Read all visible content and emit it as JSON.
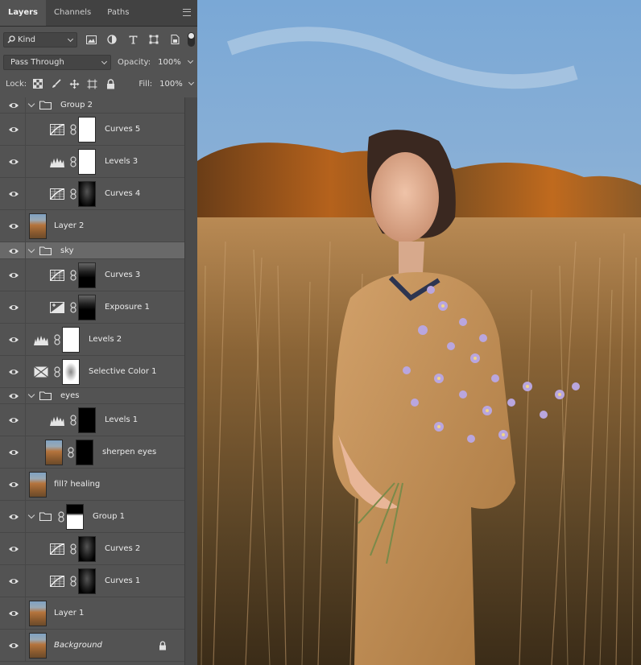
{
  "tabs": [
    "Layers",
    "Channels",
    "Paths"
  ],
  "filter": {
    "kind_label": "Kind"
  },
  "blend": {
    "mode": "Pass Through",
    "opacity_label": "Opacity:",
    "opacity_value": "100%"
  },
  "lockrow": {
    "lock_label": "Lock:",
    "fill_label": "Fill:",
    "fill_value": "100%"
  },
  "layers": [
    {
      "name": "Group 2",
      "type": "group"
    },
    {
      "name": "Curves 5",
      "type": "curves"
    },
    {
      "name": "Levels 3",
      "type": "levels"
    },
    {
      "name": "Curves 4",
      "type": "curves"
    },
    {
      "name": "Layer 2",
      "type": "pixel"
    },
    {
      "name": "sky",
      "type": "group",
      "selected": true
    },
    {
      "name": "Curves 3",
      "type": "curves"
    },
    {
      "name": "Exposure 1",
      "type": "exposure"
    },
    {
      "name": "Levels 2",
      "type": "levels"
    },
    {
      "name": "Selective Color 1",
      "type": "selective-color"
    },
    {
      "name": "eyes",
      "type": "group"
    },
    {
      "name": "Levels 1",
      "type": "levels"
    },
    {
      "name": "sherpen eyes",
      "type": "pixel"
    },
    {
      "name": "fill? healing",
      "type": "pixel"
    },
    {
      "name": "Group 1",
      "type": "group"
    },
    {
      "name": "Curves 2",
      "type": "curves"
    },
    {
      "name": "Curves 1",
      "type": "curves"
    },
    {
      "name": "Layer 1",
      "type": "pixel"
    },
    {
      "name": "Background",
      "type": "pixel",
      "locked": true
    }
  ],
  "colors": {
    "panel_bg": "#535353",
    "selected_row": "#696969",
    "tab_bar": "#424242"
  }
}
